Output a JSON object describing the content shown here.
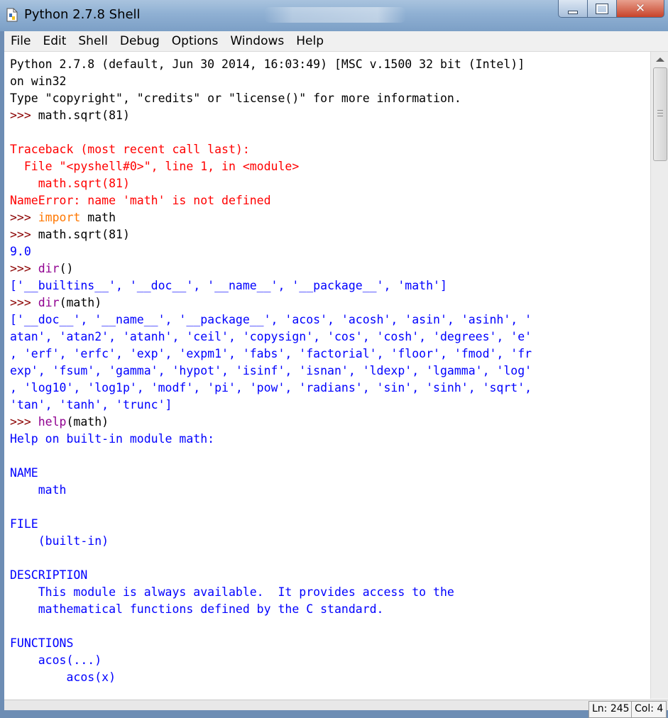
{
  "window": {
    "title": "Python 2.7.8 Shell",
    "icon": "python-file-icon",
    "controls": [
      "minimize-icon",
      "maximize-icon",
      "close-icon"
    ]
  },
  "menu": [
    "File",
    "Edit",
    "Shell",
    "Debug",
    "Options",
    "Windows",
    "Help"
  ],
  "shell_lines": [
    [
      {
        "t": "Python 2.7.8 (default, Jun 30 2014, 16:03:49) [MSC v.1500 32 bit (Intel)]",
        "c": "black"
      }
    ],
    [
      {
        "t": "on win32",
        "c": "black"
      }
    ],
    [
      {
        "t": "Type \"copyright\", \"credits\" or \"license()\" for more information.",
        "c": "black"
      }
    ],
    [
      {
        "t": ">>> ",
        "c": "prompt"
      },
      {
        "t": "math.sqrt(81)",
        "c": "black"
      }
    ],
    [],
    [
      {
        "t": "Traceback (most recent call last):",
        "c": "red"
      }
    ],
    [
      {
        "t": "  File \"<pyshell#0>\", line 1, in <module>",
        "c": "red"
      }
    ],
    [
      {
        "t": "    math.sqrt(81)",
        "c": "red"
      }
    ],
    [
      {
        "t": "NameError: name 'math' is not defined",
        "c": "red"
      }
    ],
    [
      {
        "t": ">>> ",
        "c": "prompt"
      },
      {
        "t": "import",
        "c": "kw"
      },
      {
        "t": " math",
        "c": "black"
      }
    ],
    [
      {
        "t": ">>> ",
        "c": "prompt"
      },
      {
        "t": "math.sqrt(81)",
        "c": "black"
      }
    ],
    [
      {
        "t": "9.0",
        "c": "out"
      }
    ],
    [
      {
        "t": ">>> ",
        "c": "prompt"
      },
      {
        "t": "dir",
        "c": "bi"
      },
      {
        "t": "()",
        "c": "black"
      }
    ],
    [
      {
        "t": "['__builtins__', '__doc__', '__name__', '__package__', 'math']",
        "c": "out"
      }
    ],
    [
      {
        "t": ">>> ",
        "c": "prompt"
      },
      {
        "t": "dir",
        "c": "bi"
      },
      {
        "t": "(math)",
        "c": "black"
      }
    ],
    [
      {
        "t": "['__doc__', '__name__', '__package__', 'acos', 'acosh', 'asin', 'asinh', '",
        "c": "out"
      }
    ],
    [
      {
        "t": "atan', 'atan2', 'atanh', 'ceil', 'copysign', 'cos', 'cosh', 'degrees', 'e'",
        "c": "out"
      }
    ],
    [
      {
        "t": ", 'erf', 'erfc', 'exp', 'expm1', 'fabs', 'factorial', 'floor', 'fmod', 'fr",
        "c": "out"
      }
    ],
    [
      {
        "t": "exp', 'fsum', 'gamma', 'hypot', 'isinf', 'isnan', 'ldexp', 'lgamma', 'log'",
        "c": "out"
      }
    ],
    [
      {
        "t": ", 'log10', 'log1p', 'modf', 'pi', 'pow', 'radians', 'sin', 'sinh', 'sqrt',",
        "c": "out"
      }
    ],
    [
      {
        "t": "'tan', 'tanh', 'trunc']",
        "c": "out"
      }
    ],
    [
      {
        "t": ">>> ",
        "c": "prompt"
      },
      {
        "t": "help",
        "c": "bi"
      },
      {
        "t": "(math)",
        "c": "black"
      }
    ],
    [
      {
        "t": "Help on built-in module math:",
        "c": "out"
      }
    ],
    [],
    [
      {
        "t": "NAME",
        "c": "out"
      }
    ],
    [
      {
        "t": "    math",
        "c": "out"
      }
    ],
    [],
    [
      {
        "t": "FILE",
        "c": "out"
      }
    ],
    [
      {
        "t": "    (built-in)",
        "c": "out"
      }
    ],
    [],
    [
      {
        "t": "DESCRIPTION",
        "c": "out"
      }
    ],
    [
      {
        "t": "    This module is always available.  It provides access to the",
        "c": "out"
      }
    ],
    [
      {
        "t": "    mathematical functions defined by the C standard.",
        "c": "out"
      }
    ],
    [],
    [
      {
        "t": "FUNCTIONS",
        "c": "out"
      }
    ],
    [
      {
        "t": "    acos(...)",
        "c": "out"
      }
    ],
    [
      {
        "t": "        acos(x)",
        "c": "out"
      }
    ]
  ],
  "status": {
    "line": "Ln: 245",
    "col": "Col: 4"
  },
  "colors": {
    "prompt": "#8b0000",
    "error": "#ff0000",
    "output": "#0000ff",
    "keyword": "#ff7700",
    "builtin": "#900090",
    "titlebar": "#8fb0d3"
  }
}
